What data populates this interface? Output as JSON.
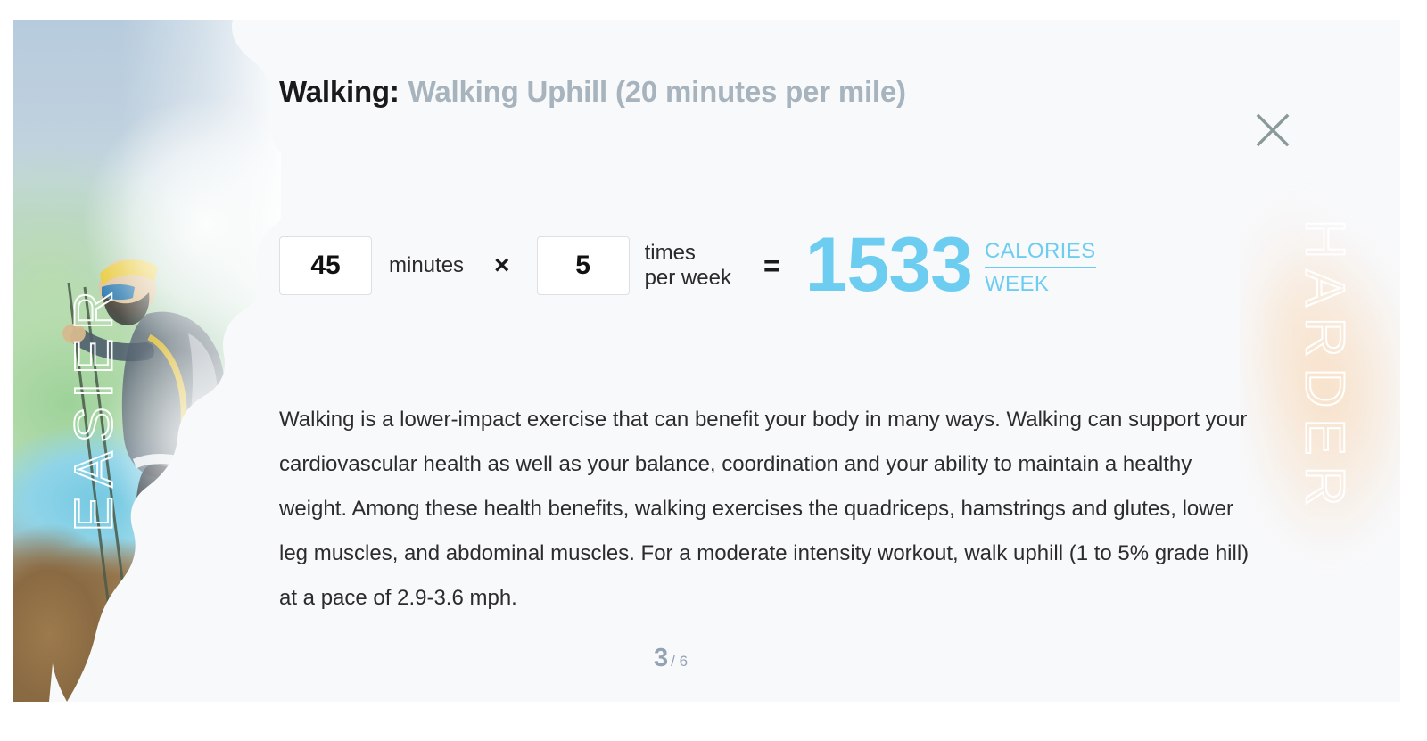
{
  "card": {
    "title_main": "Walking:",
    "title_sub": "Walking Uphill (20 minutes per mile)",
    "close_label": "×"
  },
  "slider_labels": {
    "left": "EASIER",
    "right": "HARDER"
  },
  "calculator": {
    "minutes_value": "45",
    "minutes_label": "minutes",
    "multiply_symbol": "×",
    "times_value": "5",
    "times_label_line1": "times",
    "times_label_line2": "per week",
    "equals_symbol": "=",
    "result_value": "1533",
    "result_numerator": "CALORIES",
    "result_denominator": "WEEK"
  },
  "description": "Walking is a lower-impact exercise that can benefit your body in many ways. Walking can support your cardiovascular health as well as your balance, coordination and your ability to maintain a healthy weight. Among these health benefits, walking exercises the quadriceps, hamstrings and glutes, lower leg muscles, and abdominal muscles. For a moderate intensity workout, walk uphill (1 to 5% grade hill) at a pace of 2.9-3.6 mph.",
  "pagination": {
    "current": "3",
    "total": "/ 6"
  },
  "colors": {
    "accent_blue": "#6DCDF1",
    "subtitle_grey": "#A7B3BD",
    "card_background": "#F8F9FB",
    "close_grey": "#8A9A9A"
  }
}
